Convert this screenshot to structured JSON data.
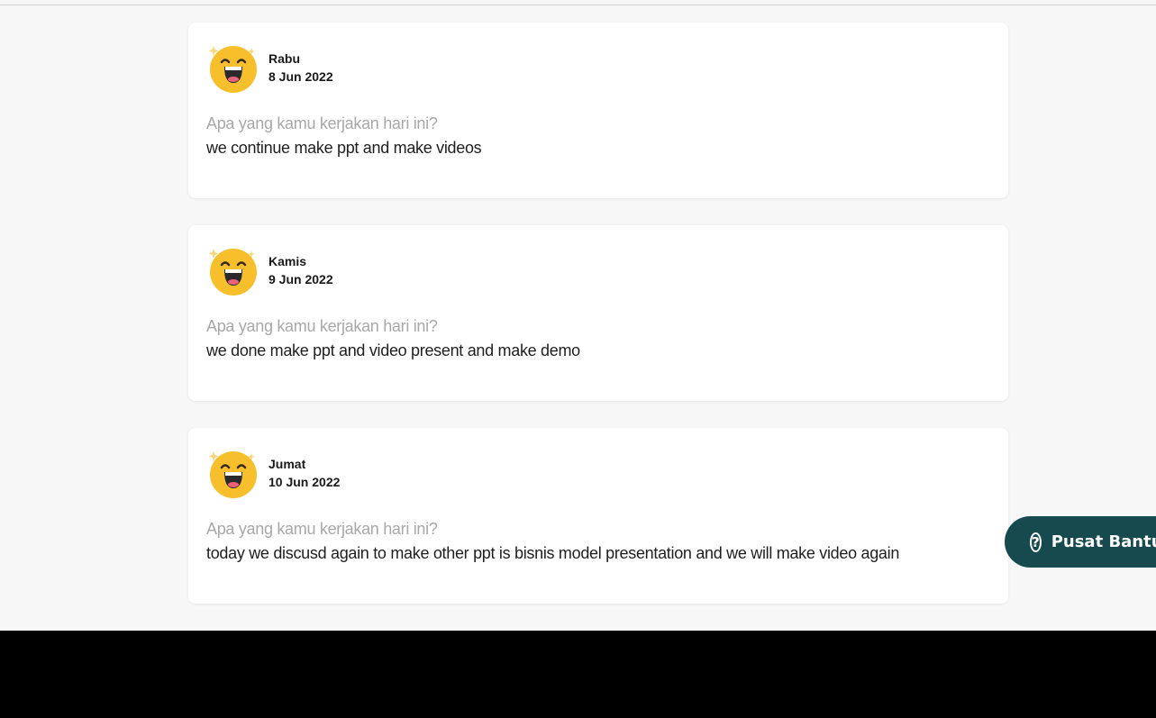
{
  "colors": {
    "page_background": "#f7f7f7",
    "card_background": "#ffffff",
    "question_text": "#a8a8a8",
    "answer_text": "#1f1f1f",
    "help_button": "#174a4f",
    "emoji_face": "#f7bf2c"
  },
  "entries": [
    {
      "mood_icon": "laughing-face-icon",
      "day": "Rabu",
      "date": "8 Jun 2022",
      "question": "Apa yang kamu kerjakan hari ini?",
      "answer": "we continue make ppt and make videos"
    },
    {
      "mood_icon": "laughing-face-icon",
      "day": "Kamis",
      "date": "9 Jun 2022",
      "question": "Apa yang kamu kerjakan hari ini?",
      "answer": "we done make ppt and video present and make demo"
    },
    {
      "mood_icon": "laughing-face-icon",
      "day": "Jumat",
      "date": "10 Jun 2022",
      "question": "Apa yang kamu kerjakan hari ini?",
      "answer": "today we discusd again to make other ppt is bisnis model presentation and we will make video again"
    }
  ],
  "help": {
    "icon": "question-circle-icon",
    "icon_glyph": "?",
    "label": "Pusat Bantuan"
  }
}
